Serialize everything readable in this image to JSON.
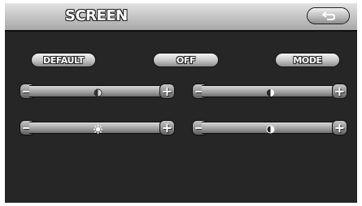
{
  "header": {
    "title": "SCREEN",
    "back_icon": "return-arrow-icon"
  },
  "buttons": {
    "default_label": "DEFAULT",
    "off_label": "OFF",
    "mode_label": "MODE"
  },
  "sliders": [
    {
      "name": "contrast",
      "icon": "contrast-half-circle-icon",
      "level": 0.5
    },
    {
      "name": "tint",
      "icon": "half-circle-icon",
      "level": 0.5
    },
    {
      "name": "brightness",
      "icon": "sun-icon",
      "level": 0.5
    },
    {
      "name": "color",
      "icon": "black-white-circle-icon",
      "level": 0.5
    }
  ],
  "colors": {
    "background": "#262626",
    "header": "#c2c2c2",
    "button": "#b8b8b8"
  }
}
